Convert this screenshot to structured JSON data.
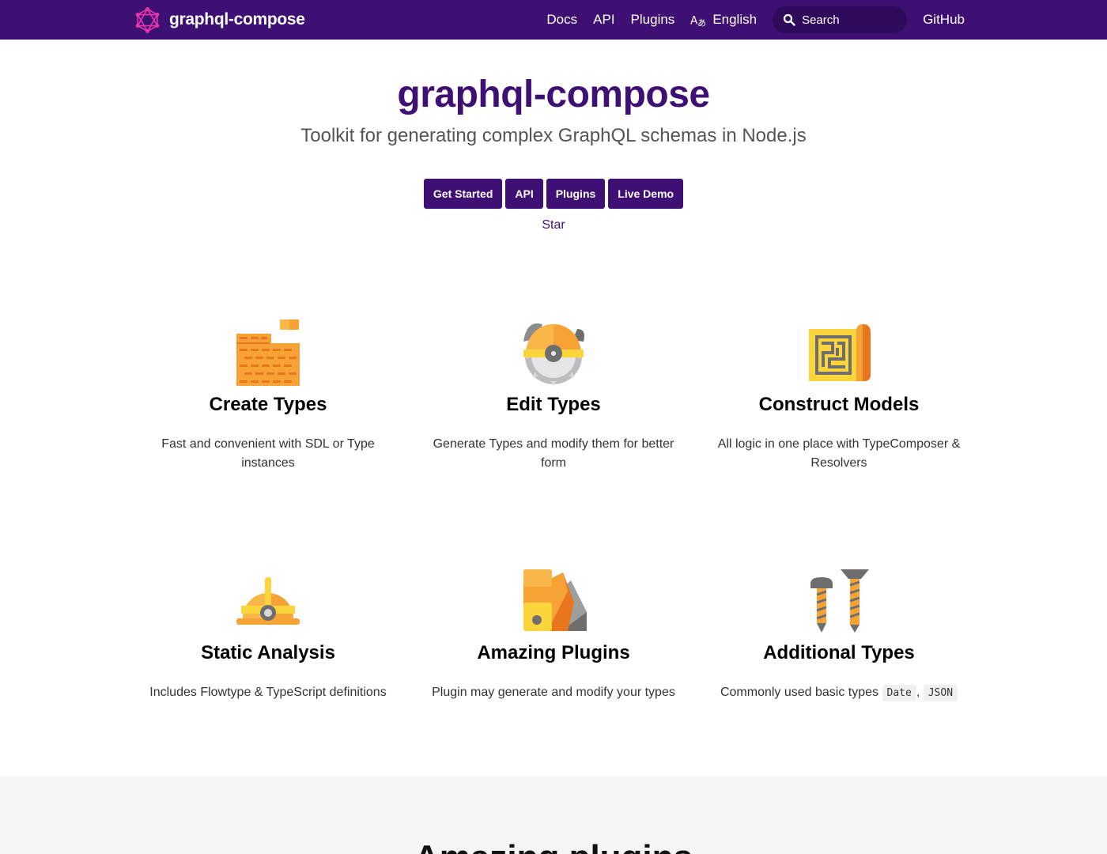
{
  "nav": {
    "brand": "graphql-compose",
    "links": {
      "docs": "Docs",
      "api": "API",
      "plugins": "Plugins",
      "language": "English",
      "github": "GitHub"
    },
    "search_placeholder": "Search",
    "colors": {
      "background": "#3f1073",
      "search_bg": "#2f0a5a",
      "logo_accent": "#e535ab"
    }
  },
  "hero": {
    "title": "graphql-compose",
    "tagline": "Toolkit for generating complex GraphQL schemas in Node.js",
    "buttons": {
      "get_started": "Get Started",
      "api": "API",
      "plugins": "Plugins",
      "live_demo": "Live Demo"
    },
    "star": "Star"
  },
  "features": [
    {
      "title": "Create Types",
      "desc": "Fast and convenient with SDL or Type instances",
      "icon": "brick-wall-icon"
    },
    {
      "title": "Edit Types",
      "desc": "Generate Types and modify them for better form",
      "icon": "circular-saw-icon"
    },
    {
      "title": "Construct Models",
      "desc": "All logic in one place with TypeComposer & Resolvers",
      "icon": "blueprint-icon"
    },
    {
      "title": "Static Analysis",
      "desc": "Includes Flowtype & TypeScript definitions",
      "icon": "hard-hat-icon"
    },
    {
      "title": "Amazing Plugins",
      "desc": "Plugin may generate and modify your types",
      "icon": "color-swatches-icon"
    },
    {
      "title": "Additional Types",
      "desc": "Commonly used basic types",
      "icon": "screws-icon",
      "codes": [
        "Date",
        "JSON"
      ],
      "separator": ","
    }
  ],
  "section2": {
    "title": "Amazing plugins"
  },
  "colors": {
    "primary": "#3f1073",
    "orange": "#f7a234",
    "dark_orange": "#e8761e",
    "yellow": "#fcd43c",
    "gray": "#6e6e6e"
  }
}
